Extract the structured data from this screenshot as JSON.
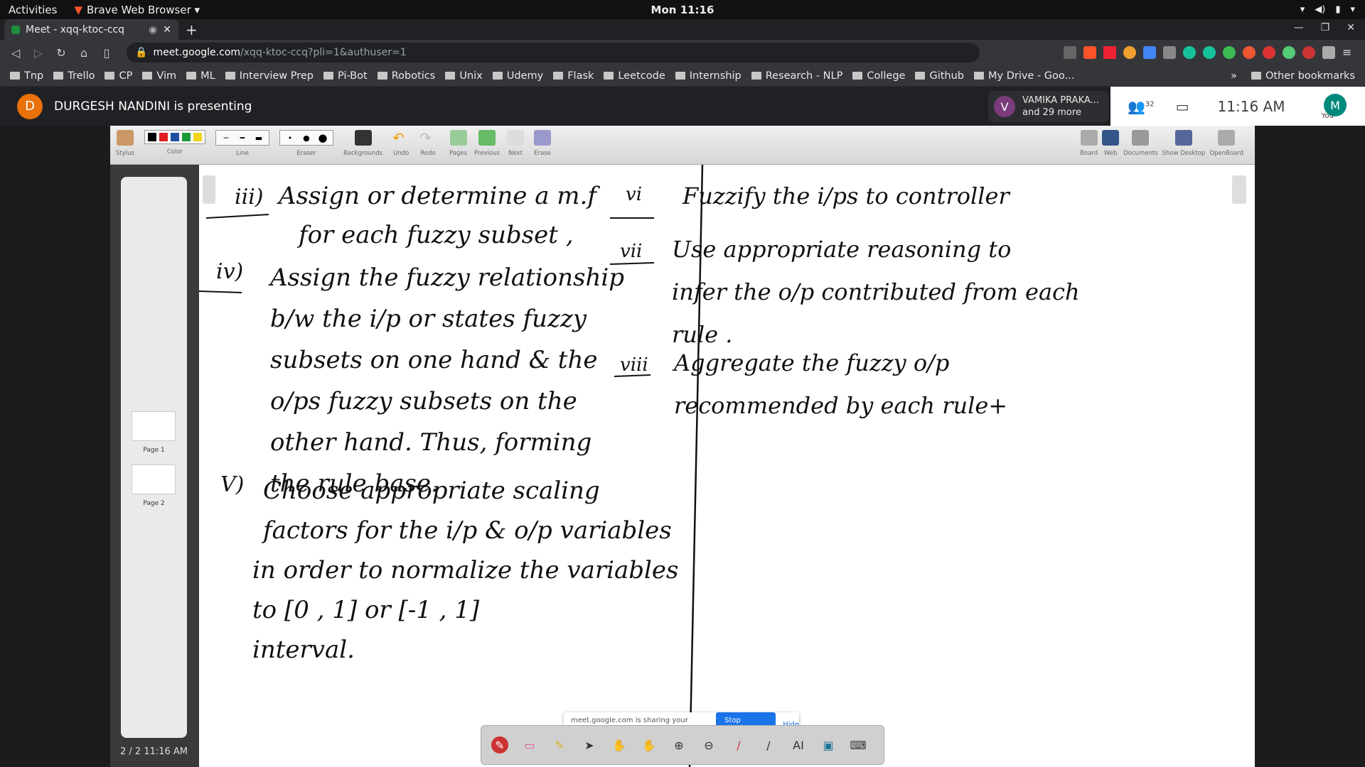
{
  "os": {
    "activities": "Activities",
    "app_name": "Brave Web Browser ▾",
    "clock": "Mon 11:16"
  },
  "browser": {
    "tab_title": "Meet - xqq-ktoc-ccq",
    "url_host": "meet.google.com",
    "url_path": "/xqq-ktoc-ccq?pli=1&authuser=1",
    "bookmarks": [
      "Tnp",
      "Trello",
      "CP",
      "Vim",
      "ML",
      "Interview Prep",
      "Pi-Bot",
      "Robotics",
      "Unix",
      "Udemy",
      "Flask",
      "Leetcode",
      "Internship",
      "Research - NLP",
      "College",
      "Github",
      "My Drive - Goo..."
    ],
    "other_bookmarks": "Other bookmarks"
  },
  "meet": {
    "presenter_initial": "D",
    "presenting_text": "DURGESH NANDINI is presenting",
    "chip_initial": "V",
    "chip_name": "VAMIKA PRAKA...",
    "chip_more": "and 29 more",
    "participant_count": "32",
    "time": "11:16 AM",
    "self_initial": "M",
    "self_label": "You"
  },
  "openboard": {
    "toolbar": [
      "Stylus",
      "Color",
      "Line",
      "Eraser",
      "Backgrounds",
      "Undo",
      "Redo",
      "Pages",
      "Previous",
      "Next",
      "Erase"
    ],
    "toolbar_right": [
      "Board",
      "Web",
      "Documents",
      "Show Desktop",
      "OpenBoard"
    ],
    "colors": [
      "#000000",
      "#e02020",
      "#1f4fa0",
      "#1a9a3a",
      "#f2d41a"
    ],
    "pages": [
      "Page 1",
      "Page 2"
    ],
    "page_counter": "2 / 2  11:16 AM"
  },
  "notes": {
    "left": [
      {
        "num": "iii)",
        "lines": [
          "Assign or determine a m.f",
          "for each fuzzy subset ,"
        ]
      },
      {
        "num": "iv)",
        "lines": [
          "Assign the fuzzy relationship",
          "b/w the i/p or states fuzzy",
          "subsets on one hand & the",
          "o/ps fuzzy subsets on the",
          "other hand. Thus, forming",
          "the rule base."
        ]
      },
      {
        "num": "V)",
        "lines": [
          "Choose appropriate scaling",
          "factors for the i/p & o/p variables",
          "in order to normalize the variables",
          "to [0 , 1] or [-1 , 1]",
          "interval."
        ]
      }
    ],
    "right": [
      {
        "num": "vi",
        "lines": [
          "Fuzzify the i/ps to controller"
        ]
      },
      {
        "num": "vii",
        "lines": [
          "Use appropriate reasoning to",
          "infer the o/p contributed from each",
          "rule ."
        ]
      },
      {
        "num": "viii",
        "lines": [
          "Aggregate the fuzzy o/p",
          "recommended by each rule+"
        ]
      }
    ]
  },
  "share": {
    "message": "meet.google.com is sharing your screen.",
    "stop": "Stop sharing",
    "hide": "Hide"
  }
}
